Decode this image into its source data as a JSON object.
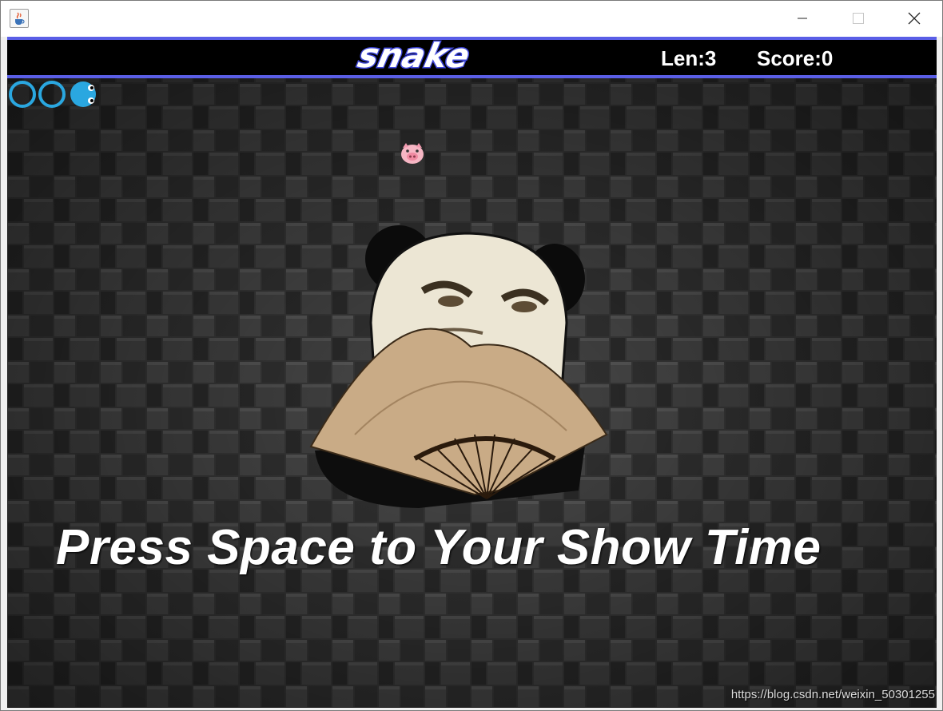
{
  "window": {
    "icon": "java-cup-icon",
    "controls": [
      "minimize-icon",
      "maximize-icon",
      "close-icon"
    ]
  },
  "header": {
    "logo_text": "snake",
    "len_text": "Len:3",
    "score_text": "Score:0",
    "accent_color": "#5a5ee6"
  },
  "snake": {
    "length": 3,
    "color": "#2aa7e0"
  },
  "food": {
    "icon": "pig-face-icon"
  },
  "mascot": {
    "icon": "panda-with-fan-icon"
  },
  "message": {
    "text": "Press Space to Your Show Time"
  },
  "watermark": {
    "text": "https://blog.csdn.net/weixin_50301255"
  }
}
